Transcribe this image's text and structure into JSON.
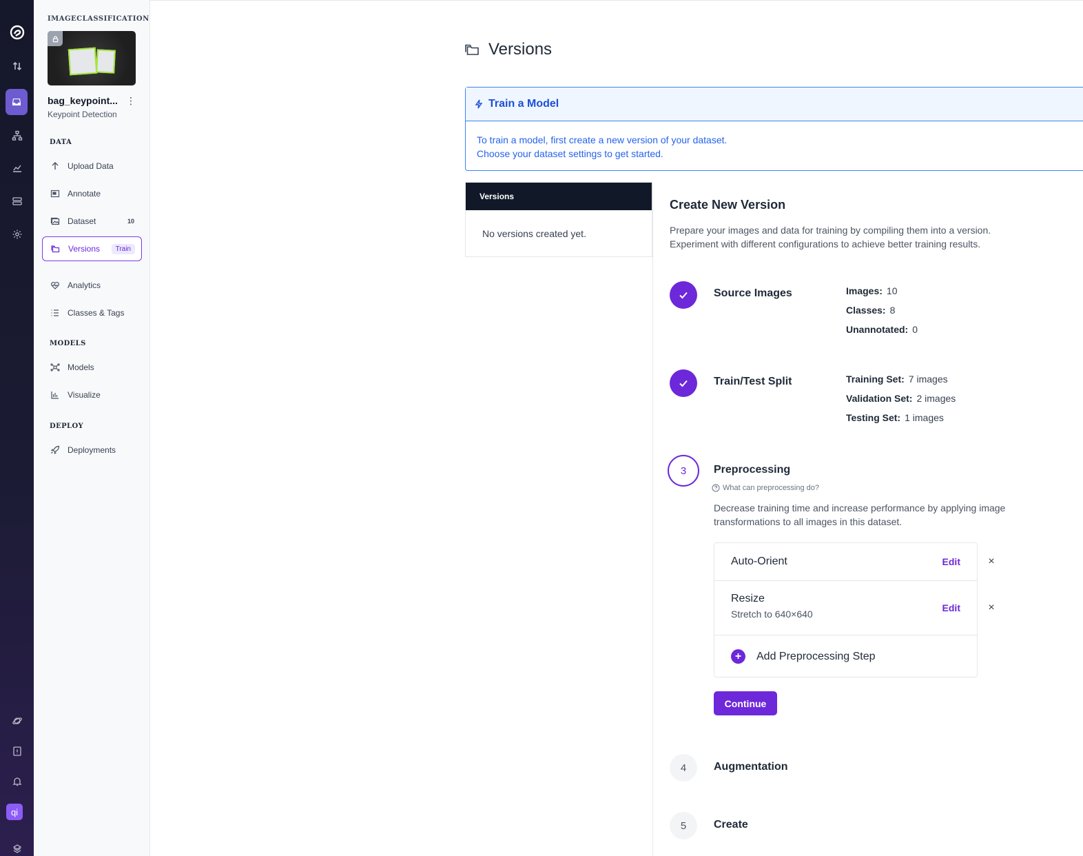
{
  "rail": {
    "icons": [
      "logo-icon",
      "transfer-icon",
      "projects-icon",
      "workflows-icon",
      "analytics-icon",
      "storage-icon",
      "settings-icon",
      "universe-icon",
      "docs-icon",
      "bell-icon"
    ],
    "avatar": "qi"
  },
  "sidebar": {
    "workspace": "IMAGECLASSIFICATION",
    "project_name": "bag_keypoint...",
    "project_type": "Keypoint Detection",
    "kebab": "⋮",
    "sections": {
      "data": "DATA",
      "models": "MODELS",
      "deploy": "DEPLOY"
    },
    "items": {
      "upload": "Upload Data",
      "annotate": "Annotate",
      "dataset": "Dataset",
      "dataset_count": "10",
      "versions": "Versions",
      "versions_badge": "Train",
      "analytics": "Analytics",
      "classes": "Classes & Tags",
      "models": "Models",
      "visualize": "Visualize",
      "deployments": "Deployments"
    }
  },
  "page": {
    "title": "Versions"
  },
  "alert": {
    "title": "Train a Model",
    "line1": "To train a model, first create a new version of your dataset.",
    "line2": "Choose your dataset settings to get started."
  },
  "versions_panel": {
    "header": "Versions",
    "empty": "No versions created yet."
  },
  "create": {
    "title": "Create New Version",
    "desc1": "Prepare your images and data for training by compiling them into a version.",
    "desc2": "Experiment with different configurations to achieve better training results.",
    "source": {
      "label": "Source Images",
      "images_k": "Images:",
      "images_v": "10",
      "classes_k": "Classes:",
      "classes_v": "8",
      "unannotated_k": "Unannotated:",
      "unannotated_v": "0"
    },
    "split": {
      "label": "Train/Test Split",
      "train_k": "Training Set:",
      "train_v": "7 images",
      "valid_k": "Validation Set:",
      "valid_v": "2 images",
      "test_k": "Testing Set:",
      "test_v": "1 images"
    },
    "preprocessing": {
      "num": "3",
      "label": "Preprocessing",
      "help": "What can preprocessing do?",
      "desc1": "Decrease training time and increase performance by applying image",
      "desc2": "transformations to all images in this dataset.",
      "steps": [
        {
          "name": "Auto-Orient",
          "sub": "",
          "edit": "Edit"
        },
        {
          "name": "Resize",
          "sub": "Stretch to 640×640",
          "edit": "Edit"
        }
      ],
      "add": "Add Preprocessing Step",
      "continue": "Continue"
    },
    "augmentation": {
      "num": "4",
      "label": "Augmentation"
    },
    "create_step": {
      "num": "5",
      "label": "Create"
    }
  }
}
